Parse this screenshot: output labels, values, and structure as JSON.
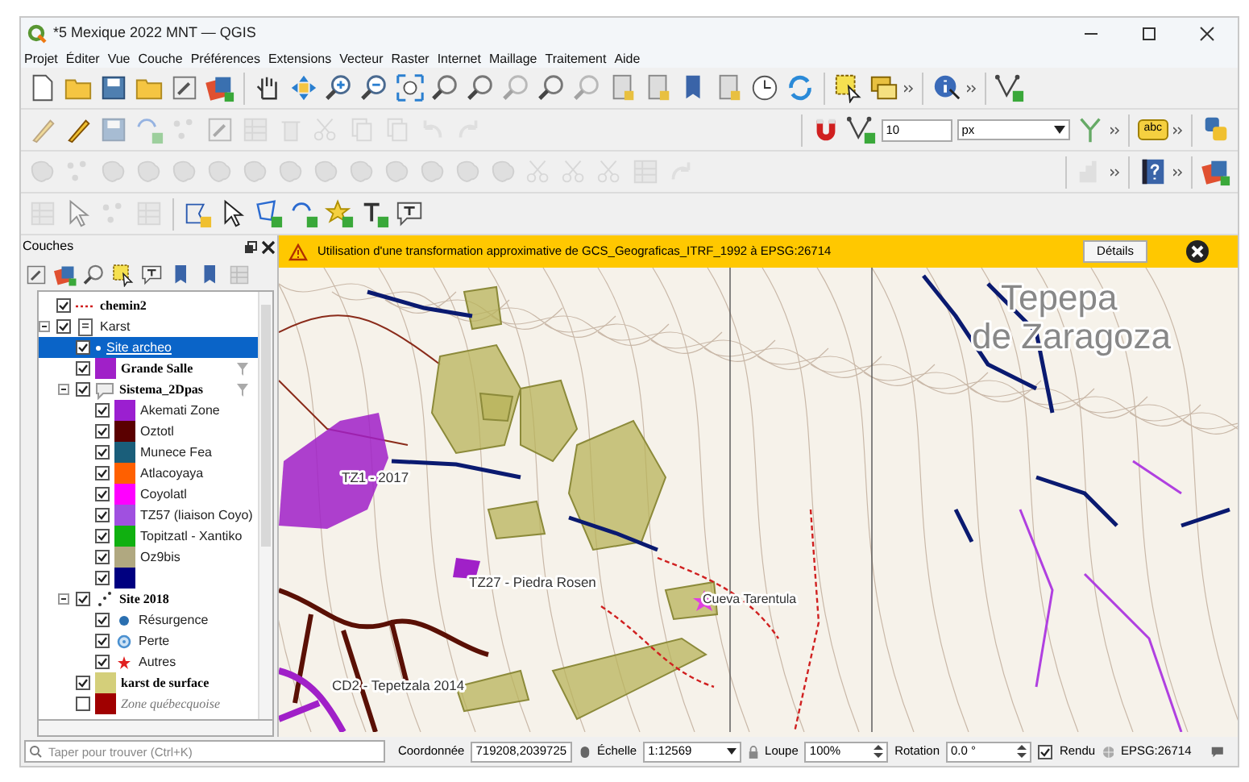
{
  "window": {
    "title": "*5 Mexique 2022 MNT — QGIS"
  },
  "menu": [
    "Projet",
    "Éditer",
    "Vue",
    "Couche",
    "Préférences",
    "Extensions",
    "Vecteur",
    "Raster",
    "Internet",
    "Maillage",
    "Traitement",
    "Aide"
  ],
  "toolbar": {
    "snapping_tolerance": "10",
    "units": "px",
    "label_tool": "abc"
  },
  "layers_panel": {
    "title": "Couches",
    "layers": [
      {
        "label": "chemin2",
        "kind": "line",
        "checked": true,
        "selected": false,
        "color": "#d02020"
      },
      {
        "label": "Karst",
        "kind": "group",
        "checked": true,
        "selected": false,
        "expanded": true,
        "children": [
          {
            "label": "Site archeo",
            "kind": "point",
            "checked": true,
            "selected": true
          },
          {
            "label": "Grande Salle",
            "kind": "fill",
            "checked": true,
            "selected": false,
            "color": "#a020c8",
            "filtered": true
          },
          {
            "label": "Sistema_2Dpas",
            "kind": "categorized",
            "checked": true,
            "selected": false,
            "filtered": true,
            "expanded": true,
            "children": [
              {
                "label": "Akemati Zone",
                "kind": "fill",
                "checked": true,
                "selected": false,
                "color": "#9b1fd0"
              },
              {
                "label": "Oztotl",
                "kind": "fill",
                "checked": true,
                "selected": false,
                "color": "#5a0000"
              },
              {
                "label": "Munece Fea",
                "kind": "fill",
                "checked": true,
                "selected": false,
                "color": "#1a5e7a"
              },
              {
                "label": "Atlacoyaya",
                "kind": "fill",
                "checked": true,
                "selected": false,
                "color": "#ff6000"
              },
              {
                "label": "Coyolatl",
                "kind": "fill",
                "checked": true,
                "selected": false,
                "color": "#ff00ff"
              },
              {
                "label": "TZ57 (liaison Coyo)",
                "kind": "fill",
                "checked": true,
                "selected": false,
                "color": "#a050e0"
              },
              {
                "label": "Topitzatl - Xantiko",
                "kind": "fill",
                "checked": true,
                "selected": false,
                "color": "#10b010"
              },
              {
                "label": "Oz9bis",
                "kind": "fill",
                "checked": true,
                "selected": false,
                "color": "#b0a880"
              },
              {
                "kind": "fill",
                "checked": true,
                "selected": false,
                "color": "#000080"
              }
            ]
          },
          {
            "label": "Site 2018",
            "kind": "points",
            "checked": true,
            "selected": false,
            "expanded": true,
            "children": [
              {
                "label": "Résurgence",
                "kind": "dot",
                "checked": true,
                "selected": false,
                "color": "#2a6fb0"
              },
              {
                "label": "Perte",
                "kind": "ring",
                "checked": true,
                "selected": false,
                "color": "#4a90d0"
              },
              {
                "label": "Autres",
                "kind": "star",
                "checked": true,
                "selected": false,
                "color": "#e02020"
              }
            ]
          },
          {
            "label": "karst de surface",
            "kind": "fill",
            "checked": true,
            "selected": false,
            "color": "#d4cf7a"
          },
          {
            "label": "Zone québecquoise",
            "kind": "fill",
            "checked": false,
            "selected": false,
            "out_of_scale": true,
            "color": "#a00000"
          }
        ]
      }
    ]
  },
  "message_bar": {
    "text": "Utilisation d'une transformation approximative de GCS_Geograficas_ITRF_1992 à EPSG:26714",
    "button": "Détails"
  },
  "map": {
    "labels": [
      "Tepepa",
      "de Zaragoza",
      "TZ1 - 2017",
      "TZ27 - Piedra Rosen",
      "Cueva Tarentula",
      "CD2 - Tepetzala 2014"
    ]
  },
  "status_bar": {
    "search_placeholder": "Taper pour trouver (Ctrl+K)",
    "coordinate_label": "Coordonnée",
    "coordinate": "719208,2039725",
    "scale_label": "Échelle",
    "scale": "1:12569",
    "magnifier_label": "Loupe",
    "magnifier": "100%",
    "rotation_label": "Rotation",
    "rotation": "0.0 °",
    "render_label": "Rendu",
    "render": true,
    "crs": "EPSG:26714"
  }
}
